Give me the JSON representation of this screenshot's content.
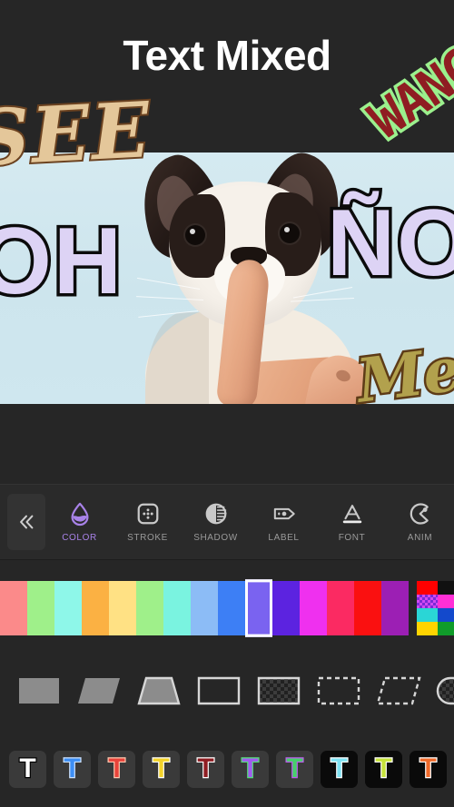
{
  "header": {
    "title": "Text Mixed"
  },
  "canvas": {
    "background_color": "#cfe6ee",
    "photo_description": "french-bulldog-puppy-shh-finger",
    "text_layers": [
      {
        "text": "SEE",
        "fill": "#e4c79a",
        "stroke": "#6b4220",
        "rotation": -3,
        "style": "serif-italic-outline"
      },
      {
        "text": "WANG",
        "fill": "#8f1d22",
        "stroke": "#9bf08d",
        "rotation": -34,
        "style": "pixel-outline"
      },
      {
        "text": "OH",
        "fill": "#ddd3f5",
        "stroke": "#0b0b0b",
        "rotation": 0,
        "style": "bold-outline"
      },
      {
        "text": "ÑO",
        "fill": "#ddd3f5",
        "stroke": "#0b0b0b",
        "rotation": 0,
        "style": "bold-outline"
      },
      {
        "text": "Me",
        "fill": "#b2a14d",
        "stroke": "#5d3b17",
        "rotation": -7,
        "style": "serif-italic-outline"
      }
    ],
    "scribble_layer": "hand-drawn-scribble"
  },
  "toolbar": {
    "collapse_label": "«",
    "active_color": "#a882e8",
    "items": [
      {
        "label": "COLOR",
        "icon": "water-drop-icon",
        "active": true
      },
      {
        "label": "STROKE",
        "icon": "stroke-square-icon",
        "active": false
      },
      {
        "label": "SHADOW",
        "icon": "shadow-circle-icon",
        "active": false
      },
      {
        "label": "LABEL",
        "icon": "tag-icon",
        "active": false
      },
      {
        "label": "FONT",
        "icon": "font-a-icon",
        "active": false
      },
      {
        "label": "ANIM",
        "icon": "anim-pac-icon",
        "active": false
      }
    ]
  },
  "color_palette": {
    "selected_index": 9,
    "swatches": [
      "#fb8a8a",
      "#9ff08a",
      "#8ef7e9",
      "#fbb143",
      "#ffe184",
      "#9ff08a",
      "#7af3e0",
      "#8cbcf6",
      "#3d7ff5",
      "#7a63f0",
      "#5c23e0",
      "#ef30ef",
      "#fb2a62",
      "#fa1010",
      "#9c1fb4"
    ],
    "grid_palette": [
      "#ff0000",
      "#111111",
      "#d248f2",
      "#ff2fd6",
      "#2ad6d6",
      "#1349cc",
      "#ffd400",
      "#109c2a"
    ]
  },
  "shape_styles": [
    {
      "name": "rectangle-solid",
      "shape": "rect",
      "fill": "solid"
    },
    {
      "name": "parallelogram-solid",
      "shape": "parallel",
      "fill": "solid"
    },
    {
      "name": "trapezoid-solid",
      "shape": "trapezoid",
      "fill": "solid"
    },
    {
      "name": "rectangle-outline",
      "shape": "rect",
      "fill": "none"
    },
    {
      "name": "rectangle-transparent",
      "shape": "rect",
      "fill": "checker"
    },
    {
      "name": "rectangle-dashed",
      "shape": "rect",
      "fill": "dashed"
    },
    {
      "name": "parallelogram-dashed",
      "shape": "parallel",
      "fill": "dashed"
    },
    {
      "name": "pill-transparent",
      "shape": "pill",
      "fill": "checker"
    }
  ],
  "text_presets": [
    {
      "glyph": "T",
      "fill": "#ffffff",
      "stroke": "#000000",
      "bg": "#3a3a3a"
    },
    {
      "glyph": "T",
      "fill": "#3d8ef5",
      "stroke": "#cfe4ff",
      "bg": "#3a3a3a"
    },
    {
      "glyph": "T",
      "fill": "#e8433a",
      "stroke": "#ffc9b0",
      "bg": "#3a3a3a"
    },
    {
      "glyph": "T",
      "fill": "#f3d32a",
      "stroke": "#ffffff",
      "bg": "#3a3a3a"
    },
    {
      "glyph": "T",
      "fill": "#8f1d22",
      "stroke": "#ffffff",
      "bg": "#3a3a3a"
    },
    {
      "glyph": "T",
      "fill": "#a25bf0",
      "stroke": "#56e07a",
      "bg": "#3a3a3a"
    },
    {
      "glyph": "T",
      "fill": "#46d06a",
      "stroke": "#c05cf0",
      "bg": "#3a3a3a"
    },
    {
      "glyph": "T",
      "fill": "#7fe3f5",
      "stroke": "#ffffff",
      "bg": "#0a0a0a"
    },
    {
      "glyph": "T",
      "fill": "#c6e23a",
      "stroke": "#ffffff",
      "bg": "#0a0a0a"
    },
    {
      "glyph": "T",
      "fill": "#f06a2a",
      "stroke": "#ffffff",
      "bg": "#0a0a0a"
    }
  ]
}
